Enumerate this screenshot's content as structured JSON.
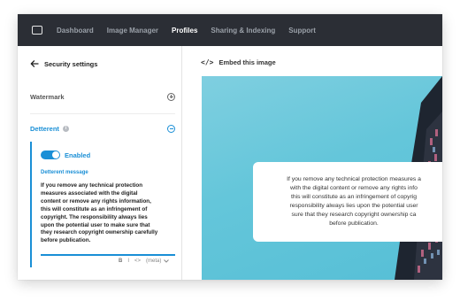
{
  "nav": {
    "items": [
      "Dashboard",
      "Image Manager",
      "Profiles",
      "Sharing & Indexing",
      "Support"
    ],
    "active": "Profiles"
  },
  "sidebar": {
    "title": "Security settings",
    "watermark_label": "Watermark",
    "deterrent_label": "Detterent",
    "toggle_label": "Enabled",
    "toggle_state": "on",
    "message_label": "Detterent message",
    "message_text": "If you remove any technical protection\nmeasures associated with the digital\ncontent or remove any rights information,\nthis will constitute as an infringement of\ncopyright. The responsibility always lies\nupon the potential user to make sure that\nthey research copyright ownership carefully\nbefore publication.",
    "format_bar": [
      "B",
      "I",
      "<>",
      "(meta)"
    ]
  },
  "embed": {
    "label": "Embed this image",
    "overlay_text": "If you remove any technical protection measures a\nwith the digital content or remove any rights info\nthis will constitute as an infringement of copyrig\nresponsibility always lies upon the potential user\nsure that they research copyright ownership ca\nbefore publication."
  },
  "colors": {
    "accent": "#1a8fd6",
    "nav_bg": "#2b2e35",
    "sky": "#64c6da"
  },
  "icons": [
    "back-arrow-icon",
    "info-icon",
    "plus-circle-icon",
    "minus-circle-icon",
    "code-icon",
    "chevron-down-icon"
  ]
}
